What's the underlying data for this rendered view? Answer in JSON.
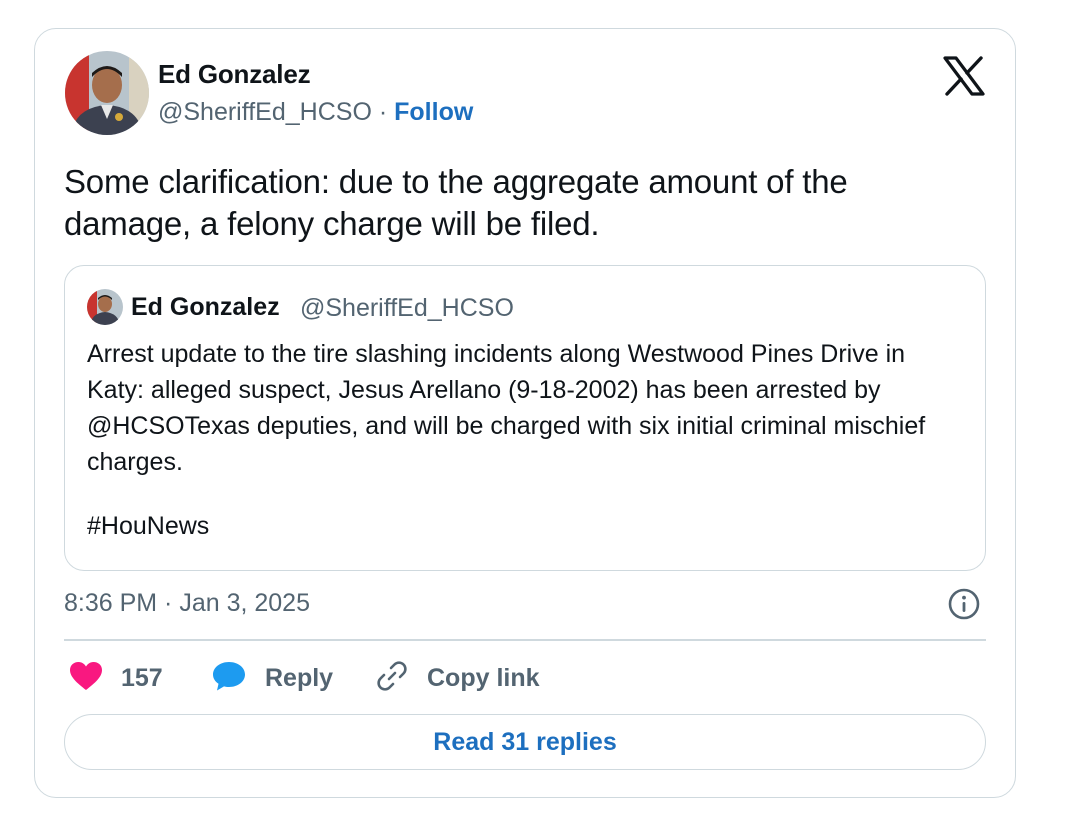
{
  "tweet": {
    "author_name": "Ed Gonzalez",
    "handle": "@SheriffEd_HCSO",
    "separator": "·",
    "follow_label": "Follow",
    "text": "Some clarification: due to the aggregate amount of the damage, a felony charge will be filed.",
    "timestamp": "8:36 PM · Jan 3, 2025"
  },
  "quoted_tweet": {
    "author_name": "Ed Gonzalez",
    "handle": "@SheriffEd_HCSO",
    "text": "Arrest update to the tire slashing incidents along Westwood Pines Drive in Katy: alleged suspect, Jesus Arellano (9-18-2002) has been arrested by @HCSOTexas deputies, and will be charged with six initial criminal mischief charges.",
    "hashtag": "#HouNews"
  },
  "actions": {
    "like_count": "157",
    "reply_label": "Reply",
    "copy_link_label": "Copy link"
  },
  "read_replies_label": "Read 31 replies",
  "icons": {
    "logo": "x-logo-icon",
    "info": "info-icon",
    "like": "heart-icon",
    "reply": "speech-bubble-icon",
    "copy": "link-icon"
  },
  "colors": {
    "accent": "#1d6fbf",
    "like": "#f91880",
    "reply": "#1d9bf0",
    "muted_text": "#536471",
    "border": "#cfd9de"
  }
}
